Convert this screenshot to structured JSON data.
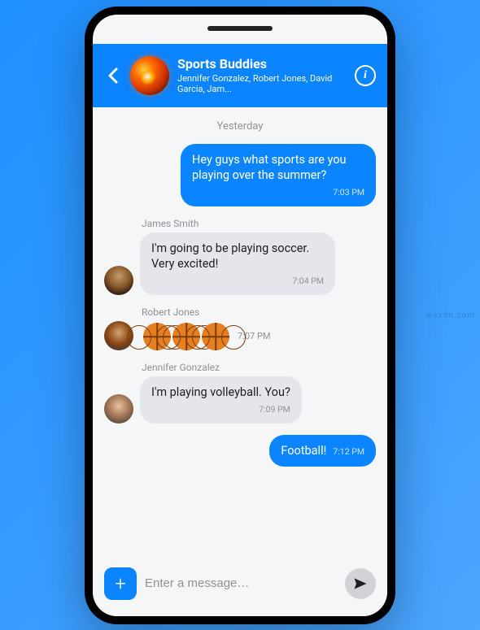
{
  "header": {
    "title": "Sports Buddies",
    "members_line": "Jennifer Gonzalez, Robert Jones, David Garcia, Jam...",
    "info_glyph": "i"
  },
  "date_separator": "Yesterday",
  "messages": [
    {
      "direction": "out",
      "text": "Hey guys what sports are you playing over the summer?",
      "time": "7:03 PM"
    },
    {
      "direction": "in",
      "sender": "James Smith",
      "text": "I'm going to be playing soccer. Very excited!",
      "time": "7:04 PM"
    },
    {
      "direction": "in",
      "sender": "Robert Jones",
      "emoji_count": 3,
      "emoji_name": "basketball",
      "time": "7:07 PM"
    },
    {
      "direction": "in",
      "sender": "Jennifer Gonzalez",
      "text": "I'm playing volleyball. You?",
      "time": "7:09 PM"
    },
    {
      "direction": "out",
      "text": "Football!",
      "time": "7:12 PM"
    }
  ],
  "composer": {
    "placeholder": "Enter a message…",
    "add_glyph": "+"
  },
  "watermark": "wsxdn.com",
  "colors": {
    "accent": "#0a84ff",
    "bubble_in": "#e4e6eb",
    "bubble_out": "#0a84ff",
    "muted": "#8e9297"
  }
}
